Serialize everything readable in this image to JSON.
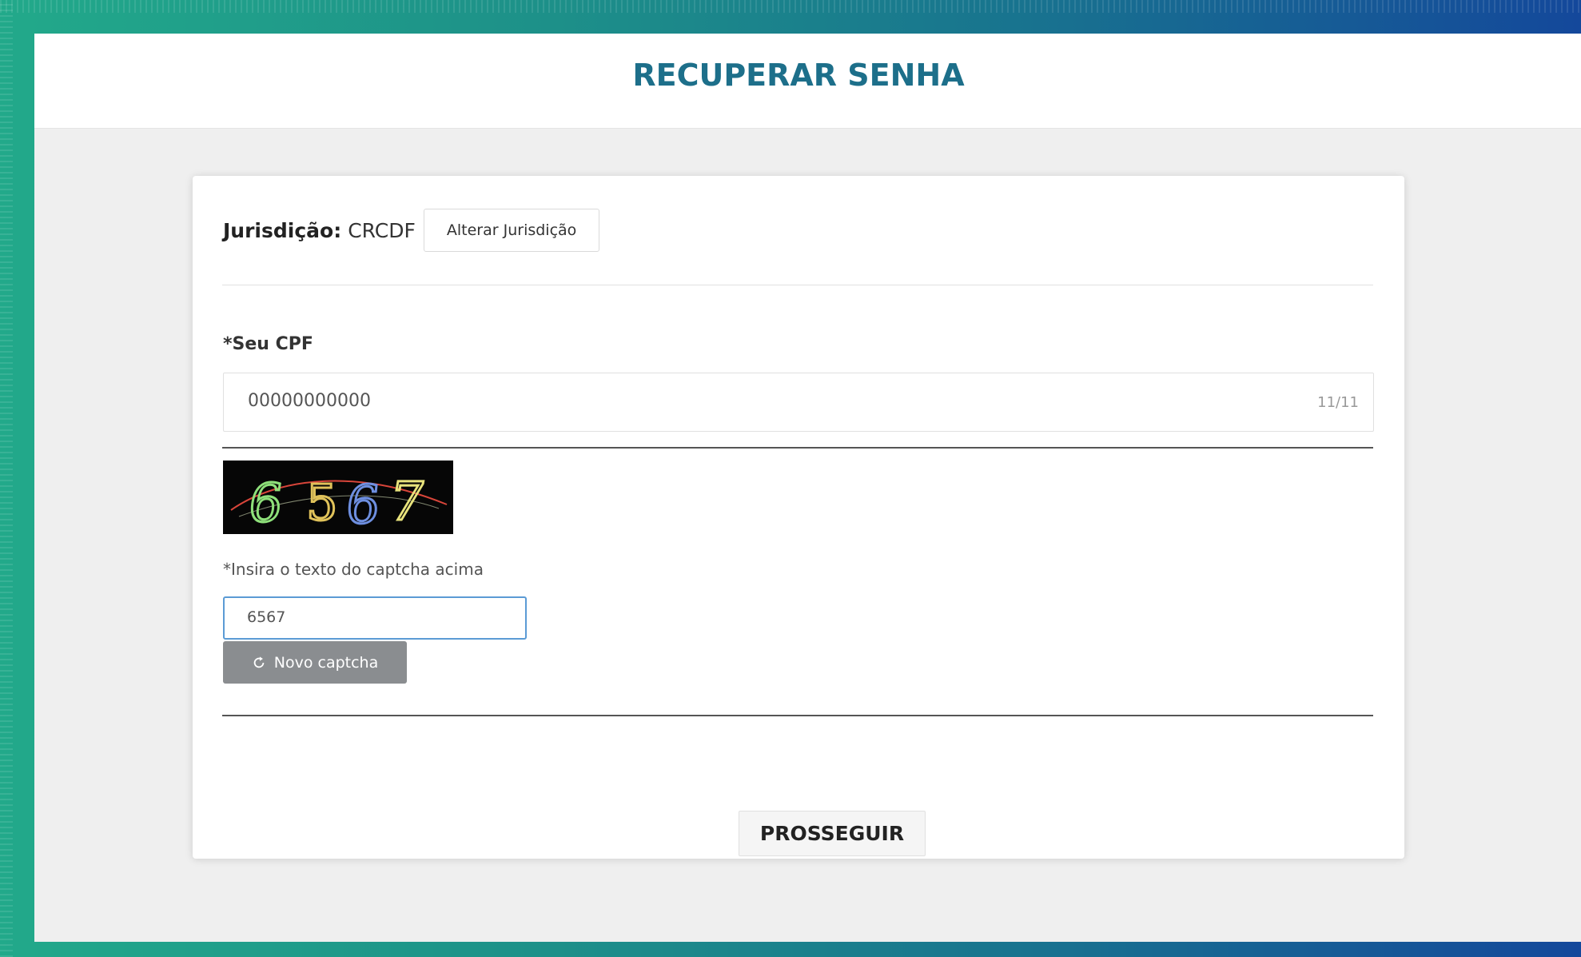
{
  "header": {
    "title": "RECUPERAR SENHA"
  },
  "form": {
    "jurisdiction": {
      "label": "Jurisdição:",
      "value": "CRCDF",
      "change_button": "Alterar Jurisdição"
    },
    "cpf": {
      "label": "*Seu CPF",
      "value": "00000000000",
      "counter": "11/11"
    },
    "captcha": {
      "image_text": "6567",
      "label": "*Insira o texto do captcha acima",
      "input_value": "6567",
      "new_captcha_button": "Novo captcha"
    },
    "submit_button": "PROSSEGUIR"
  },
  "colors": {
    "frame_gradient": [
      "#22a98a",
      "#14489b"
    ],
    "title": "#1d6f8a",
    "input_focus": "#5b9bd5",
    "secondary_button": "#8a8d90"
  },
  "icons": {
    "refresh": "refresh-icon"
  }
}
